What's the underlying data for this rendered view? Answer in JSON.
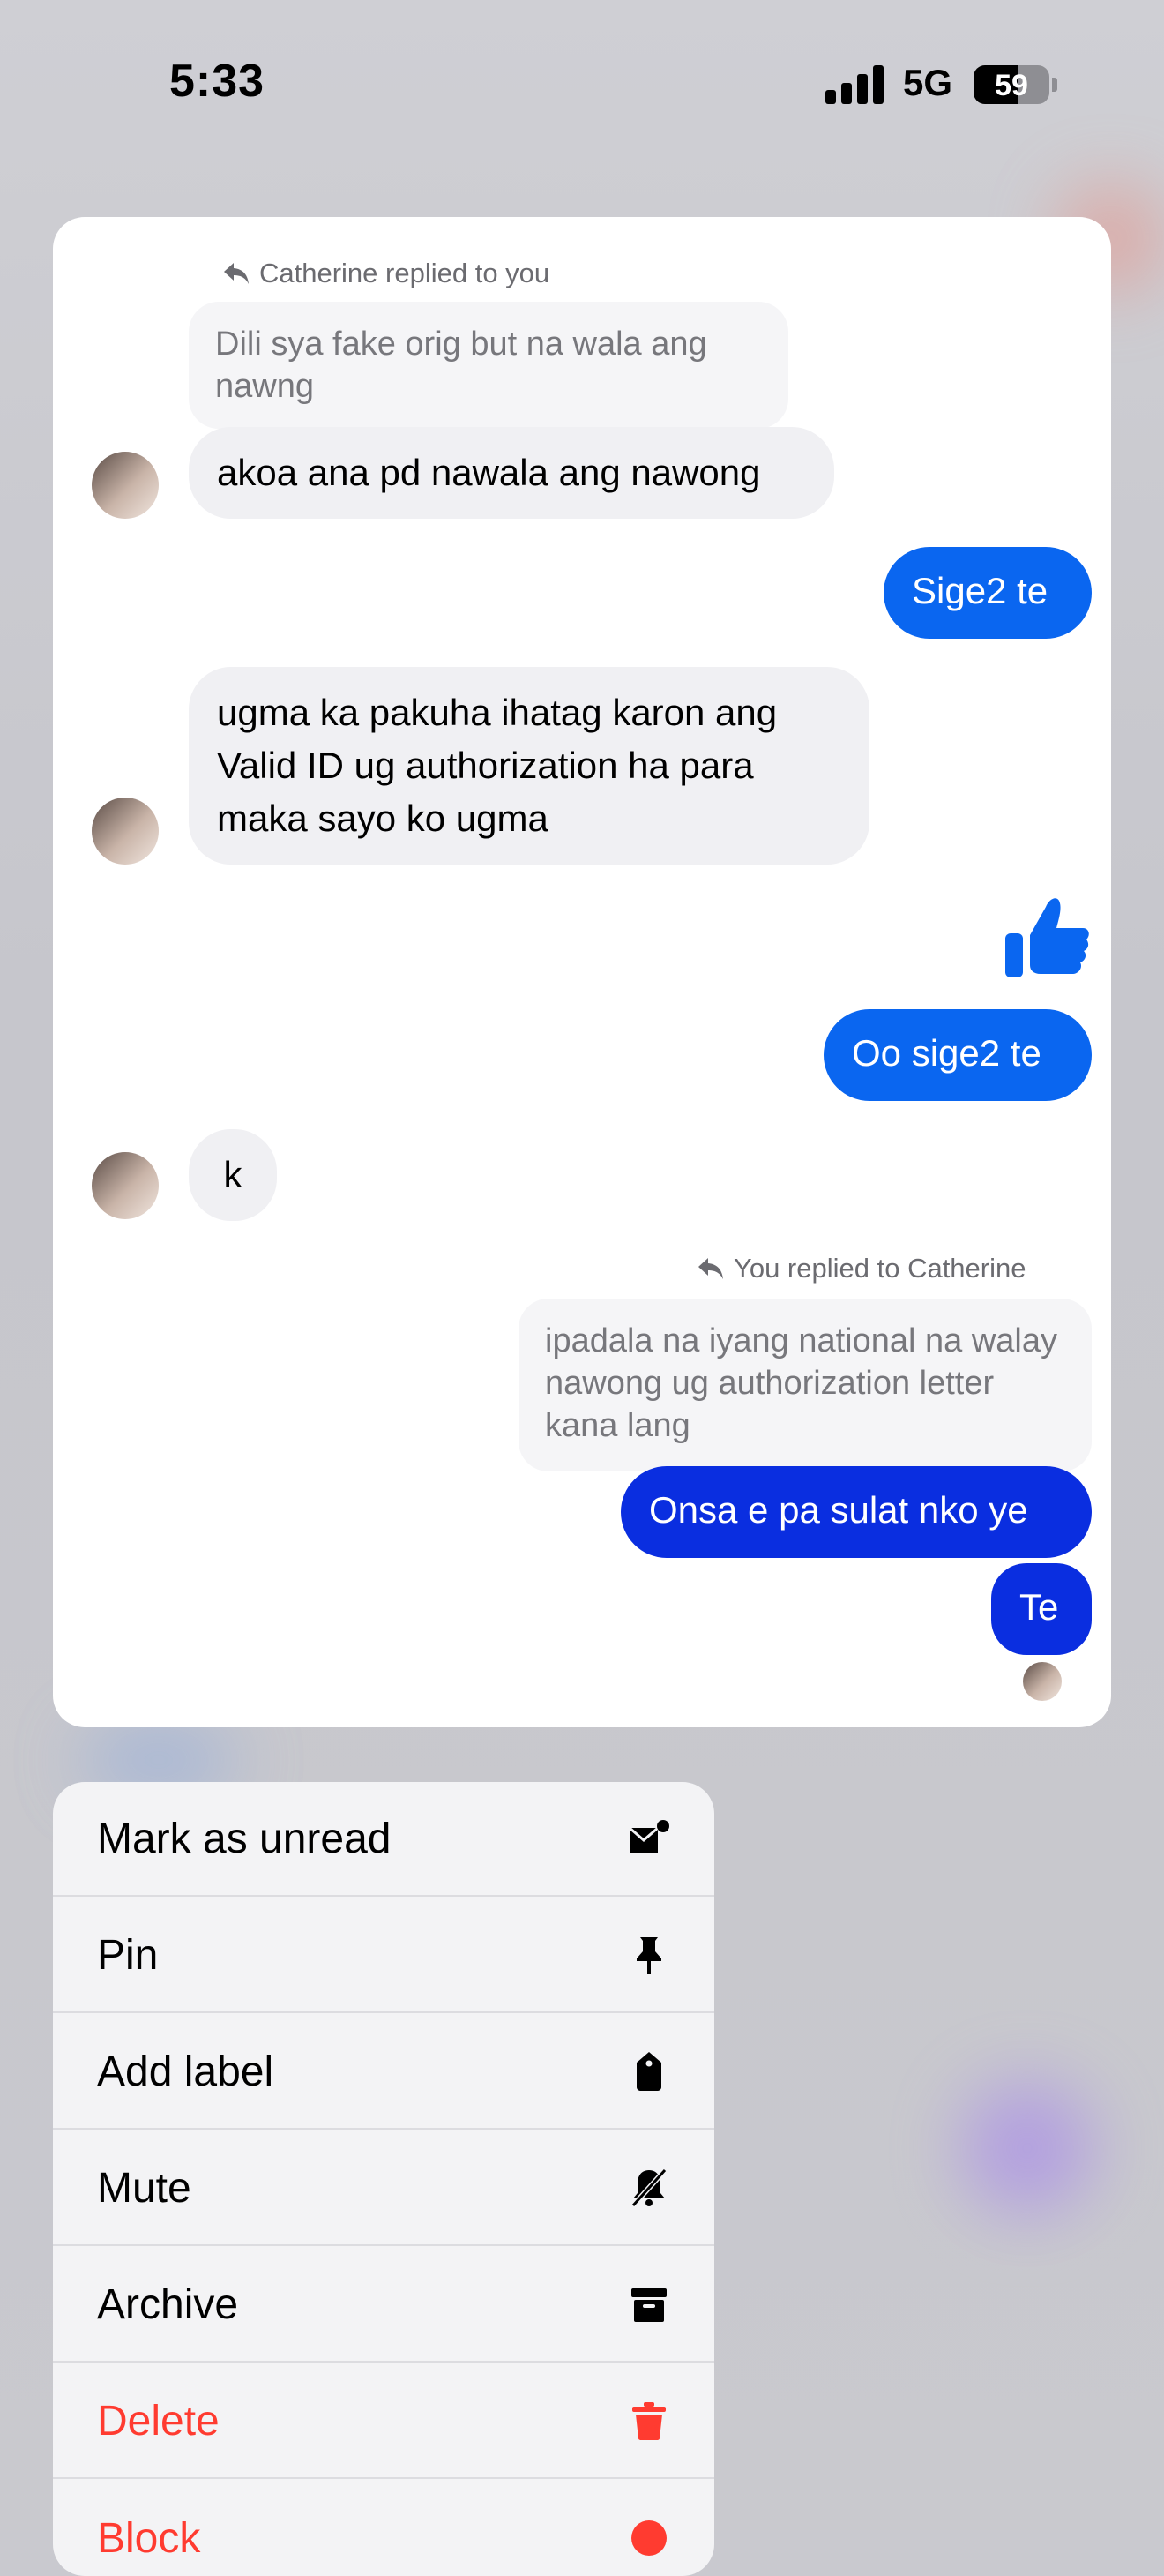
{
  "status_bar": {
    "time": "5:33",
    "network": "5G",
    "battery": "59",
    "battery_level": 0.59
  },
  "chat": {
    "reply_note_1": "Catherine replied to you",
    "quoted_1": "Dili sya fake orig but na wala ang nawng",
    "msg_1": "akoa ana pd nawala ang nawong",
    "msg_2": "Sige2 te",
    "msg_3": "ugma ka pakuha ihatag karon ang Valid ID ug authorization ha para maka sayo ko ugma",
    "msg_4": "Oo sige2 te",
    "msg_5": "k",
    "reply_note_2": "You replied to Catherine",
    "quoted_2": "ipadala na iyang national na walay nawong ug authorization letter kana lang",
    "msg_6": "Onsa e pa sulat nko ye",
    "msg_7": "Te",
    "accent_color": "#0a66f0"
  },
  "menu": {
    "items": [
      {
        "label": "Mark as unread",
        "icon": "mark-unread-icon"
      },
      {
        "label": "Pin",
        "icon": "pin-icon"
      },
      {
        "label": "Add label",
        "icon": "tag-icon"
      },
      {
        "label": "Mute",
        "icon": "bell-slash-icon"
      },
      {
        "label": "Archive",
        "icon": "archive-icon"
      },
      {
        "label": "Delete",
        "icon": "trash-icon",
        "destructive": true
      },
      {
        "label": "Block",
        "icon": "block-icon",
        "destructive": true
      }
    ],
    "destructive_color": "#ff3b30"
  }
}
